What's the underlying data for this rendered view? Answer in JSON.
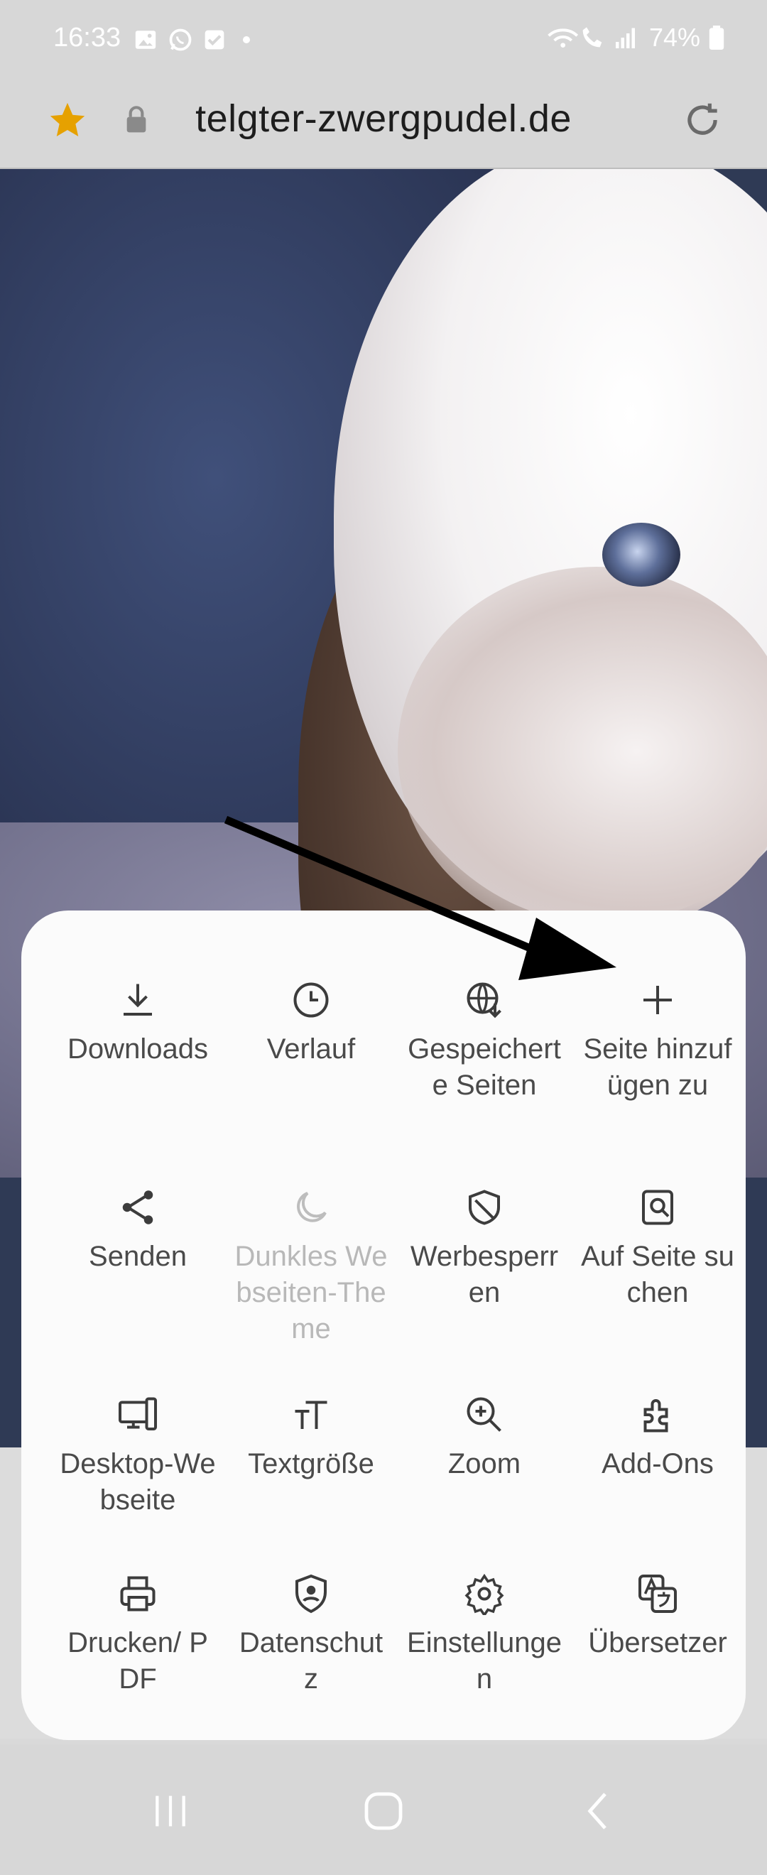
{
  "status_bar": {
    "time": "16:33",
    "battery": "74%",
    "icons": [
      "gallery-icon",
      "whatsapp-icon",
      "checkbox-icon",
      "dot-icon",
      "wifi-call-icon",
      "signal-icon",
      "battery-icon"
    ]
  },
  "address_bar": {
    "url": "telgter-zwergpudel.de",
    "star_color": "#e6a100"
  },
  "menu": {
    "items": [
      {
        "label": "Download​s",
        "icon": "download-icon"
      },
      {
        "label": "Verlauf",
        "icon": "history-icon"
      },
      {
        "label": "Gespeich​erte Seiten",
        "icon": "saved-pages-icon"
      },
      {
        "label": "Seite hinzufüge​n zu",
        "icon": "plus-icon"
      },
      {
        "label": "Senden",
        "icon": "share-icon"
      },
      {
        "label": "Dunkles Webseite​n-Theme",
        "icon": "moon-icon",
        "disabled": true
      },
      {
        "label": "Werbespe​rren",
        "icon": "ad-block-icon"
      },
      {
        "label": "Auf Seite suchen",
        "icon": "find-in-page-icon"
      },
      {
        "label": "Desktop-Webseite",
        "icon": "desktop-icon"
      },
      {
        "label": "Textgröße",
        "icon": "text-size-icon"
      },
      {
        "label": "Zoom",
        "icon": "zoom-icon"
      },
      {
        "label": "Add-Ons",
        "icon": "add-ons-icon"
      },
      {
        "label": "Drucken/ PDF",
        "icon": "print-icon"
      },
      {
        "label": "Datensch​utz",
        "icon": "privacy-icon"
      },
      {
        "label": "Einstellun​gen",
        "icon": "settings-icon"
      },
      {
        "label": "Übersetze​r",
        "icon": "translate-icon"
      }
    ]
  },
  "nav_bar": {
    "icons": [
      "recent-apps-icon",
      "home-icon",
      "back-icon"
    ]
  }
}
